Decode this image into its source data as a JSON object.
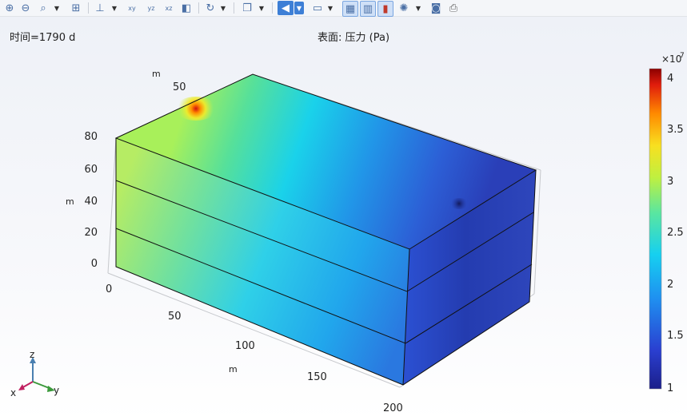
{
  "toolbar": {
    "items": [
      {
        "name": "zoom-in-icon",
        "glyph": "⊕"
      },
      {
        "name": "zoom-out-icon",
        "glyph": "⊖"
      },
      {
        "name": "zoom-box-icon",
        "glyph": "⌕"
      },
      {
        "name": "zoom-extents-icon",
        "glyph": "⊞"
      },
      {
        "name": "axis-orientation-icon",
        "glyph": "⊥"
      },
      {
        "name": "view-xy-icon",
        "glyph": "xy"
      },
      {
        "name": "view-yz-icon",
        "glyph": "yz"
      },
      {
        "name": "view-xz-icon",
        "glyph": "xz"
      },
      {
        "name": "view-3d-icon",
        "glyph": "◧"
      },
      {
        "name": "reset-view-icon",
        "glyph": "↻"
      },
      {
        "name": "scene-light-icon",
        "glyph": "❐"
      },
      {
        "name": "transparency-icon",
        "glyph": "◀"
      },
      {
        "name": "render-mode-icon",
        "glyph": "▭"
      },
      {
        "name": "show-grid-icon",
        "glyph": "▦"
      },
      {
        "name": "show-axis-icon",
        "glyph": "▥"
      },
      {
        "name": "show-legend-icon",
        "glyph": "▮"
      },
      {
        "name": "animate-icon",
        "glyph": "✺"
      },
      {
        "name": "snapshot-icon",
        "glyph": "◙"
      },
      {
        "name": "print-icon",
        "glyph": "⎙"
      }
    ]
  },
  "plot": {
    "time_label": "时间=1790 d",
    "title": "表面: 压力 (Pa)",
    "axis_unit": "m",
    "z_ticks": [
      "80",
      "60",
      "40",
      "20",
      "0"
    ],
    "y_ticks": [
      "50"
    ],
    "x_ticks": [
      "0",
      "50",
      "100",
      "150",
      "200"
    ],
    "colorbar": {
      "exponent_base": "×10",
      "exponent": "7",
      "ticks": [
        "4",
        "3.5",
        "3",
        "2.5",
        "2",
        "1.5",
        "1"
      ],
      "min": 1,
      "max": 4.1
    },
    "triad": {
      "x": "x",
      "y": "y",
      "z": "z"
    }
  }
}
